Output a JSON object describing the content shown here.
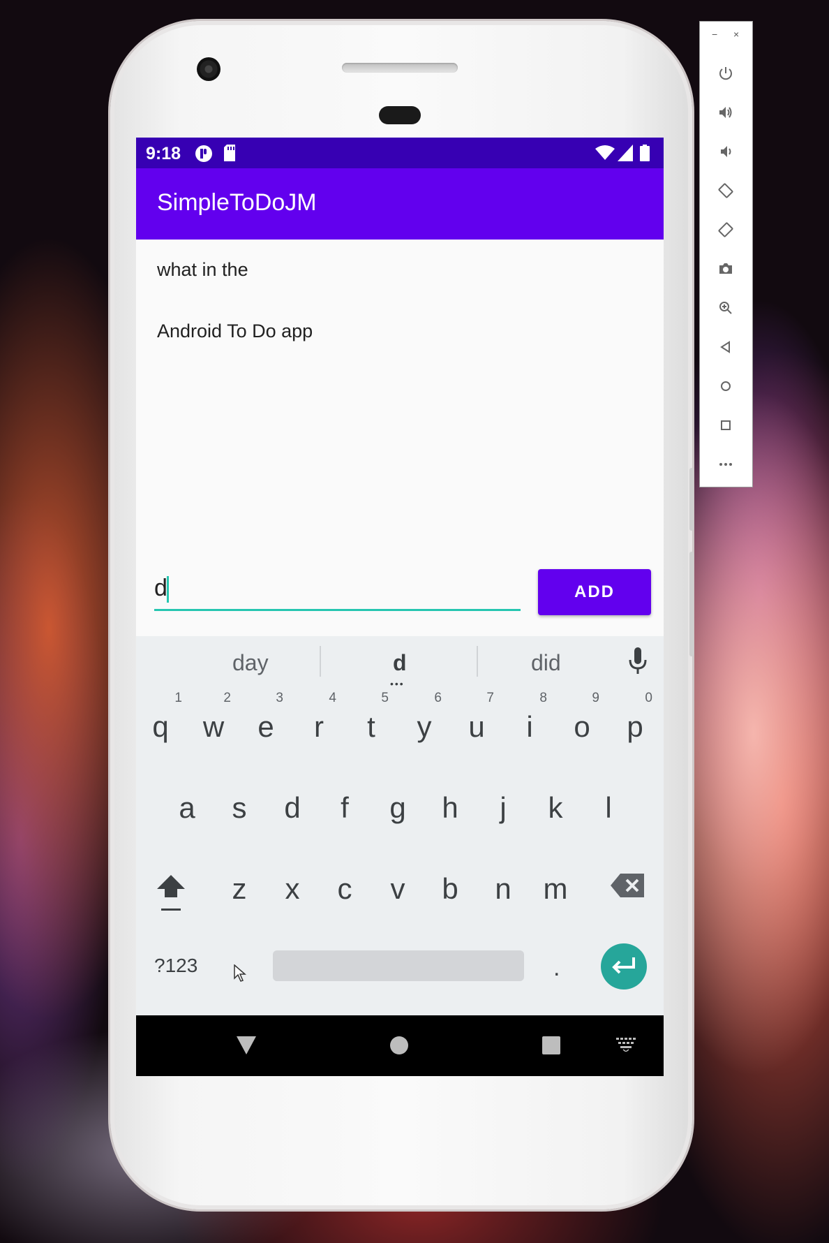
{
  "status_bar": {
    "time": "9:18"
  },
  "app": {
    "title": "SimpleToDoJM"
  },
  "todo_items": [
    "what in the",
    "Android To Do app"
  ],
  "input": {
    "value": "d"
  },
  "add_button": {
    "label": "ADD"
  },
  "keyboard": {
    "suggestions": [
      "day",
      "d",
      "did"
    ],
    "row1": [
      {
        "key": "q",
        "hint": "1"
      },
      {
        "key": "w",
        "hint": "2"
      },
      {
        "key": "e",
        "hint": "3"
      },
      {
        "key": "r",
        "hint": "4"
      },
      {
        "key": "t",
        "hint": "5"
      },
      {
        "key": "y",
        "hint": "6"
      },
      {
        "key": "u",
        "hint": "7"
      },
      {
        "key": "i",
        "hint": "8"
      },
      {
        "key": "o",
        "hint": "9"
      },
      {
        "key": "p",
        "hint": "0"
      }
    ],
    "row2": [
      "a",
      "s",
      "d",
      "f",
      "g",
      "h",
      "j",
      "k",
      "l"
    ],
    "row3": [
      "z",
      "x",
      "c",
      "v",
      "b",
      "n",
      "m"
    ],
    "symbols_key": "?123",
    "period_key": ".",
    "accent_color": "#26a69a"
  },
  "colors": {
    "primary": "#6200ee",
    "primary_dark": "#3700b3",
    "accent": "#26c6b0"
  },
  "emulator_toolbar": {
    "icons": [
      "power-icon",
      "volume-up-icon",
      "volume-down-icon",
      "rotate-left-icon",
      "rotate-right-icon",
      "camera-icon",
      "zoom-icon",
      "back-icon",
      "home-icon",
      "overview-icon",
      "more-icon"
    ]
  }
}
